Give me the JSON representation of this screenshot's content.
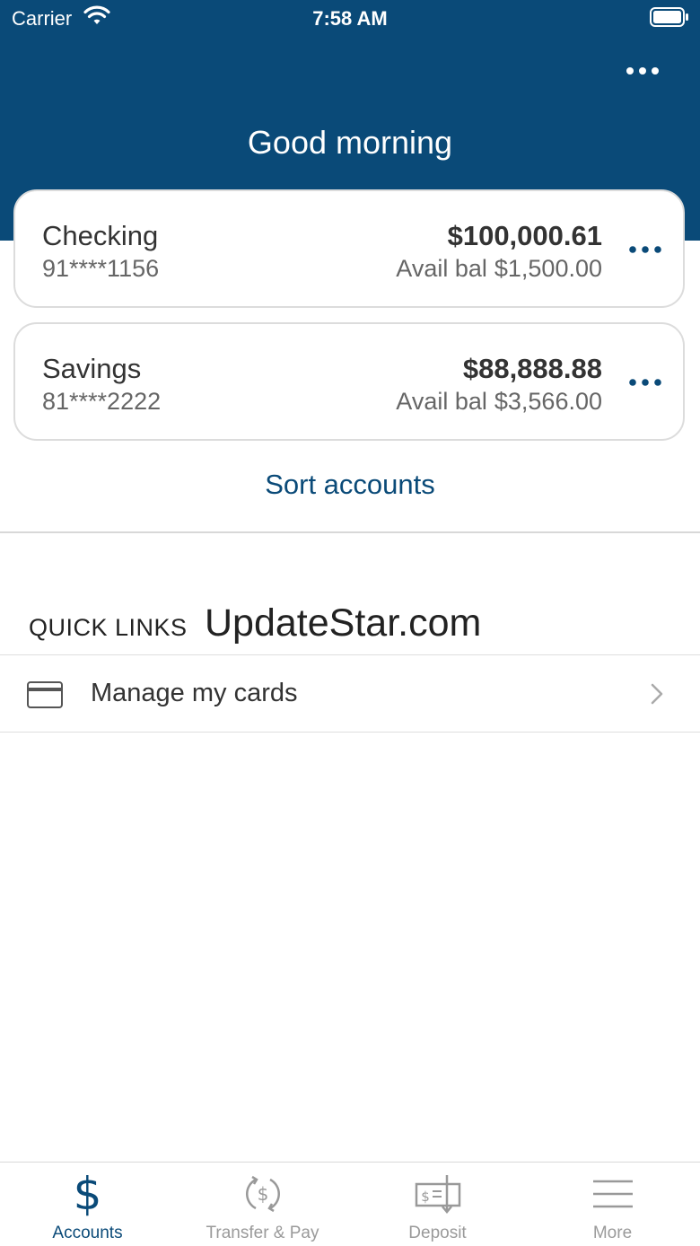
{
  "status_bar": {
    "carrier": "Carrier",
    "time": "7:58 AM"
  },
  "header": {
    "greeting": "Good morning"
  },
  "accounts": [
    {
      "name": "Checking",
      "number": "91****1156",
      "balance": "$100,000.61",
      "avail_label": "Avail bal",
      "avail_value": "$1,500.00"
    },
    {
      "name": "Savings",
      "number": "81****2222",
      "balance": "$88,888.88",
      "avail_label": "Avail bal",
      "avail_value": "$3,566.00"
    }
  ],
  "sort_label": "Sort accounts",
  "quick_links": {
    "title": "QUICK LINKS",
    "items": [
      {
        "label": "Manage my cards",
        "icon": "credit-card-icon"
      }
    ]
  },
  "watermark": "UpdateStar.com",
  "tabbar": {
    "tabs": [
      {
        "label": "Accounts",
        "icon": "dollar-icon",
        "active": true
      },
      {
        "label": "Transfer & Pay",
        "icon": "transfer-icon",
        "active": false
      },
      {
        "label": "Deposit",
        "icon": "deposit-check-icon",
        "active": false
      },
      {
        "label": "More",
        "icon": "menu-icon",
        "active": false
      }
    ]
  },
  "colors": {
    "brand": "#0a4a78",
    "inactive_tab": "#9a9a9a",
    "text": "#333333"
  }
}
